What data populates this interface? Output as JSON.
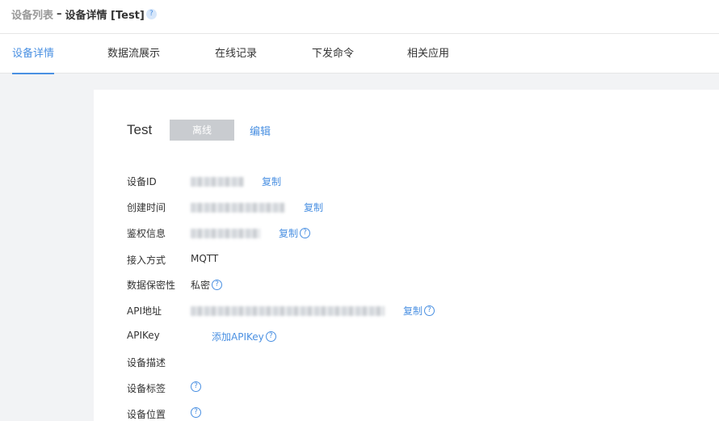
{
  "breadcrumb": {
    "parent": "设备列表",
    "separator": "–",
    "current": "设备详情 [Test]",
    "help_icon": "?"
  },
  "tabs": [
    {
      "label": "设备详情",
      "active": true
    },
    {
      "label": "数据流展示",
      "active": false
    },
    {
      "label": "在线记录",
      "active": false
    },
    {
      "label": "下发命令",
      "active": false
    },
    {
      "label": "相关应用",
      "active": false
    }
  ],
  "device": {
    "name": "Test",
    "status": "离线",
    "edit_label": "编辑"
  },
  "fields": {
    "device_id": {
      "label": "设备ID",
      "action": "复制"
    },
    "created_time": {
      "label": "创建时间",
      "action": "复制"
    },
    "auth_info": {
      "label": "鉴权信息",
      "action": "复制"
    },
    "access_method": {
      "label": "接入方式",
      "value": "MQTT"
    },
    "data_privacy": {
      "label": "数据保密性",
      "value": "私密"
    },
    "api_address": {
      "label": "API地址",
      "action": "复制"
    },
    "api_key": {
      "label": "APIKey",
      "action": "添加APIKey"
    },
    "description": {
      "label": "设备描述"
    },
    "tags": {
      "label": "设备标签"
    },
    "location": {
      "label": "设备位置"
    }
  },
  "colors": {
    "accent": "#4a90e2",
    "status_offline_bg": "#c9ccd0",
    "page_bg": "#f2f3f5"
  },
  "icons": {
    "help": "question-circle-icon"
  }
}
